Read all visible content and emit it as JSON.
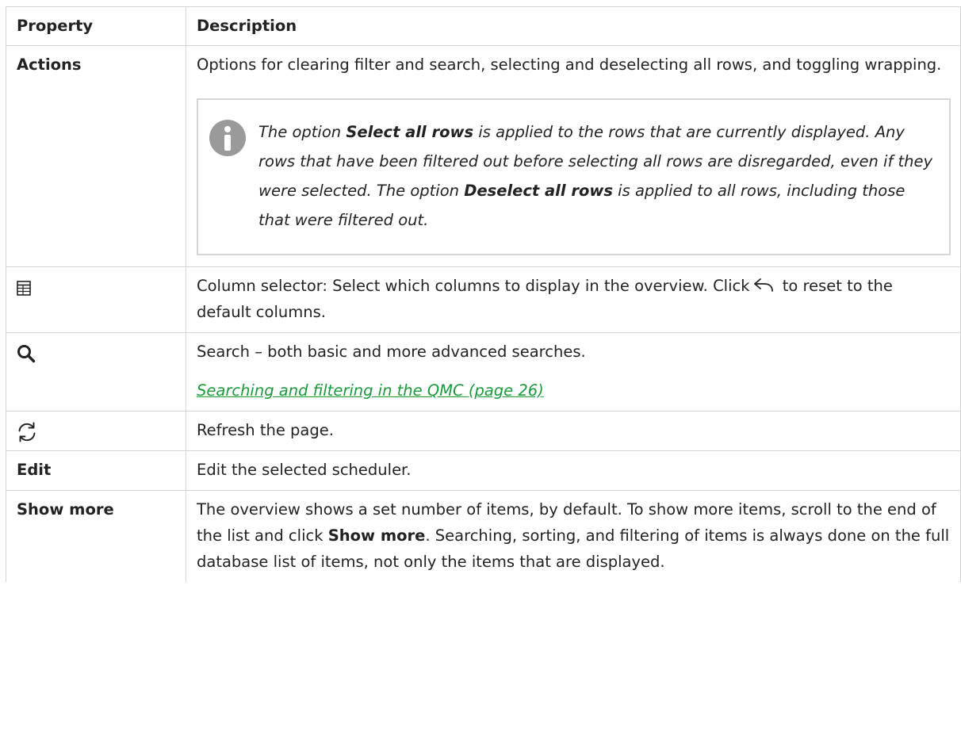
{
  "header": {
    "property": "Property",
    "description": "Description"
  },
  "rows": {
    "actions": {
      "property": "Actions",
      "description": "Options for clearing filter and search, selecting and deselecting all rows, and toggling wrapping.",
      "note": {
        "icon": "info-icon",
        "t1": "The option ",
        "b1": "Select all rows",
        "t2": " is applied to the rows that are currently displayed. Any rows that have been filtered out before selecting all rows are disregarded, even if they were selected. The option ",
        "b2": "Deselect all rows",
        "t3": " is applied to all rows, including those that were filtered out."
      }
    },
    "column_selector": {
      "icon": "table-icon",
      "desc_before": "Column selector: Select which columns to display in the overview. Click",
      "inline_icon": "undo-arrow-icon",
      "desc_after": " to reset to the default columns."
    },
    "search": {
      "icon": "search-icon",
      "description": "Search – both basic and more advanced searches.",
      "link": " Searching and filtering in the QMC (page 26)"
    },
    "refresh": {
      "icon": "refresh-icon",
      "description": "Refresh the page."
    },
    "edit": {
      "property": "Edit",
      "description": "Edit the selected scheduler."
    },
    "show_more": {
      "property": "Show more",
      "d1": "The overview shows a set number of items, by default. To show more items, scroll to the end of the list and click ",
      "bold": "Show more",
      "d2": ". Searching, sorting, and filtering of items is always done on the full database list of items, not only the items that are displayed."
    }
  },
  "colors": {
    "link": "#1a9a3b",
    "border": "#d4d4d4",
    "text": "#222222",
    "note_icon": "#9a9a9a"
  }
}
